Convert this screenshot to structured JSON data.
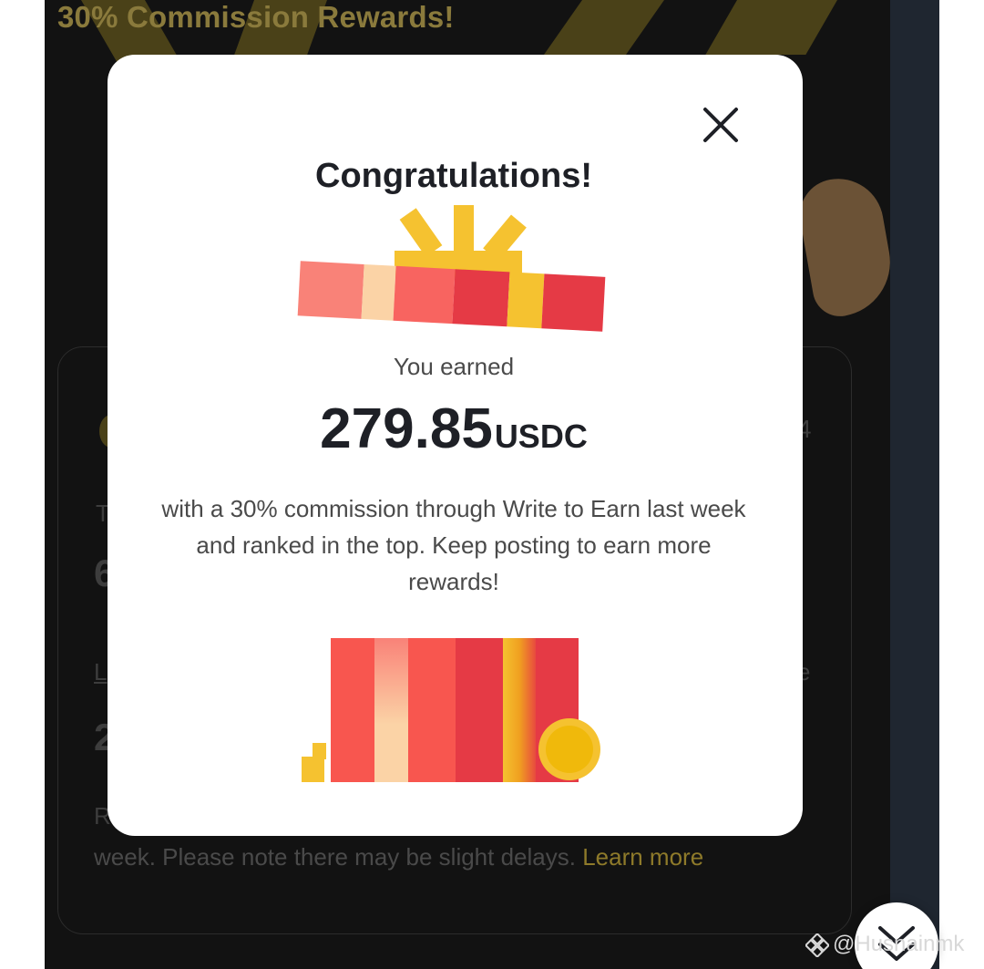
{
  "background": {
    "banner_title": "30% Commission Rewards!",
    "note_text": "week. Please note there may be slight delays.",
    "note_link": "Learn more",
    "colors": {
      "page_bg": "#121212",
      "accent_gold": "#8e7a2a"
    }
  },
  "modal": {
    "title": "Congratulations!",
    "earned_label": "You earned",
    "amount": "279.85",
    "currency": "USDC",
    "description": "with a 30% commission through Write to Earn last week and ranked in the top. Keep posting to earn more rewards!",
    "close_icon": "close-icon",
    "colors": {
      "card_bg": "#ffffff",
      "text_primary": "#1e2026",
      "gift_red": "#e84a4f",
      "gift_gold": "#f0b90b"
    }
  },
  "scroll_button": {
    "icon": "chevron-down-icon"
  },
  "watermark": {
    "text": "@Husnainmk"
  }
}
